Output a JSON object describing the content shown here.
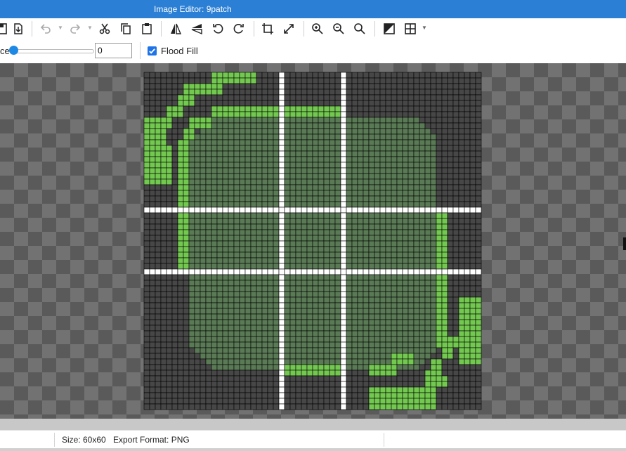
{
  "window": {
    "title": "Image Editor: 9patch"
  },
  "toolbar": {
    "buttons": [
      {
        "name": "save-icon"
      },
      {
        "name": "import-icon"
      },
      {
        "name": "undo-icon"
      },
      {
        "name": "redo-icon"
      },
      {
        "name": "cut-icon"
      },
      {
        "name": "copy-icon"
      },
      {
        "name": "paste-icon"
      },
      {
        "name": "flip-horizontal-icon"
      },
      {
        "name": "flip-vertical-icon"
      },
      {
        "name": "rotate-left-icon"
      },
      {
        "name": "rotate-right-icon"
      },
      {
        "name": "crop-icon"
      },
      {
        "name": "resize-icon"
      },
      {
        "name": "zoom-in-icon"
      },
      {
        "name": "zoom-out-icon"
      },
      {
        "name": "zoom-actual-icon"
      },
      {
        "name": "invert-icon"
      },
      {
        "name": "grid-icon"
      }
    ]
  },
  "options": {
    "tolerance_label": "ce",
    "tolerance_value": "0",
    "flood_fill_label": "Flood Fill",
    "flood_fill_checked": true
  },
  "status": {
    "size": "Size: 60x60",
    "format": "Export Format: PNG"
  },
  "image": {
    "width": 60,
    "height": 60,
    "colors": {
      "bright": "#73c950",
      "fill": "#5a7a55",
      "dark": "#474747",
      "white": "#ffffff",
      "gridline": "#000000"
    },
    "white_columns": [
      24,
      35
    ],
    "white_rows": [
      24,
      35
    ],
    "bright_strips": [
      [
        12,
        0,
        8,
        2
      ],
      [
        7,
        2,
        7,
        2
      ],
      [
        6,
        4,
        3,
        2
      ],
      [
        4,
        6,
        3,
        2
      ],
      [
        12,
        6,
        23,
        2
      ],
      [
        0,
        8,
        5,
        2
      ],
      [
        8,
        8,
        4,
        2
      ],
      [
        0,
        10,
        4,
        3
      ],
      [
        7,
        10,
        2,
        2
      ],
      [
        6,
        12,
        2,
        2
      ],
      [
        0,
        13,
        5,
        7
      ],
      [
        6,
        14,
        2,
        21
      ],
      [
        52,
        25,
        2,
        24
      ],
      [
        56,
        40,
        4,
        12
      ],
      [
        54,
        47,
        2,
        2
      ],
      [
        53,
        49,
        2,
        2
      ],
      [
        51,
        51,
        2,
        2
      ],
      [
        50,
        53,
        3,
        2
      ],
      [
        25,
        52,
        10,
        2
      ],
      [
        40,
        52,
        5,
        2
      ],
      [
        44,
        50,
        4,
        2
      ],
      [
        40,
        56,
        12,
        4
      ],
      [
        50,
        54,
        4,
        2
      ]
    ]
  }
}
